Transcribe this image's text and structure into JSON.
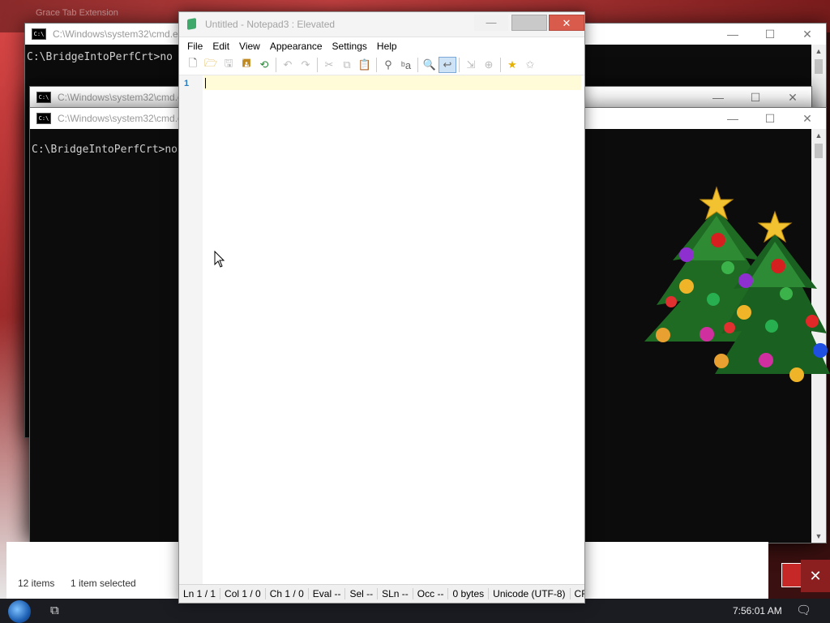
{
  "background": {
    "browser_tab_title": "Grace Tab Extension",
    "cmd_title": "C:\\Windows\\system32\\cmd.exe",
    "cmd_prompt": "C:\\BridgeIntoPerfCrt>no",
    "window_controls": {
      "minimize": "—",
      "maximize": "☐",
      "close": "✕"
    }
  },
  "explorer": {
    "item_count": "12 items",
    "selected": "1 item selected"
  },
  "taskbar": {
    "clock": "7:56:01 AM"
  },
  "notepad": {
    "title": "Untitled - Notepad3 : Elevated",
    "controls": {
      "minimize": "—",
      "maximize": "",
      "close": "✕"
    },
    "menu": [
      "File",
      "Edit",
      "View",
      "Appearance",
      "Settings",
      "Help"
    ],
    "line_number": "1",
    "status": {
      "ln": "Ln  1 / 1",
      "col": "Col  1 / 0",
      "ch": "Ch  1 / 0",
      "eval": "Eval  --",
      "sel": "Sel  --",
      "sln": "SLn  --",
      "occ": "Occ  --",
      "size": "0 bytes",
      "encoding": "Unicode (UTF-8)",
      "eol": "CR+"
    }
  },
  "colors": {
    "current_line": "#fffbd9",
    "line_number": "#2b7bbd",
    "close_button": "#d95b4b",
    "taskbar": "#1b1c22"
  },
  "icons": [
    "new-file-icon",
    "open-icon",
    "save-icon",
    "save-as-icon",
    "revert-icon",
    "undo-icon",
    "redo-icon",
    "cut-icon",
    "copy-icon",
    "paste-icon",
    "find-icon",
    "replace-icon",
    "zoom-find-icon",
    "word-wrap-icon",
    "split-icon",
    "zoom-icon",
    "favorite-icon",
    "add-favorite-icon"
  ]
}
